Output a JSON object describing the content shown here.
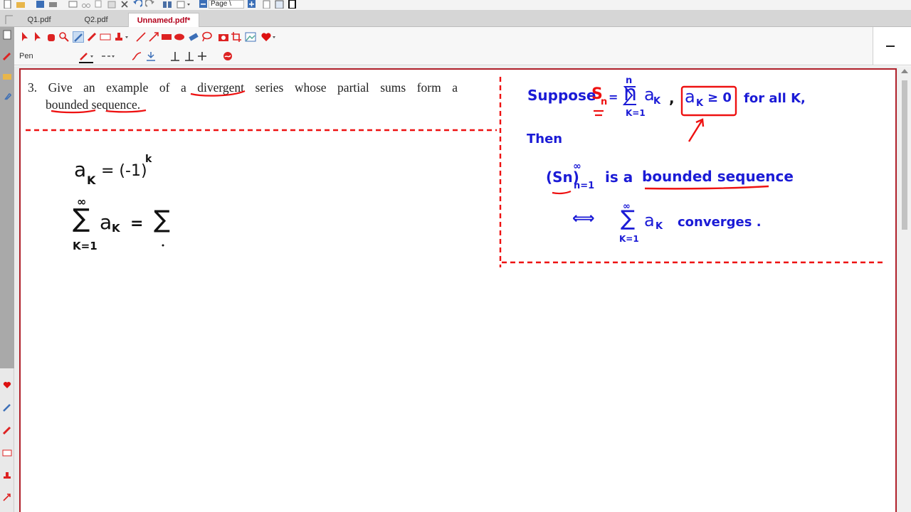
{
  "tabs": [
    {
      "label": "Q1.pdf",
      "active": false
    },
    {
      "label": "Q2.pdf",
      "active": false
    },
    {
      "label": "Unnamed.pdf*",
      "active": true
    }
  ],
  "quick_toolbar": {
    "page_dropdown": "Page \\"
  },
  "ribbon": {
    "tool_label": "Pen",
    "collapse_symbol": "–"
  },
  "problem": {
    "number": "3.",
    "line1_words": [
      "Give",
      "an",
      "example",
      "of",
      "a",
      "divergent",
      "series",
      "whose",
      "partial",
      "sums",
      "form",
      "a"
    ],
    "line2": "bounded sequence."
  },
  "handwriting": {
    "left": {
      "line1_base": "a",
      "line1_sub": "K",
      "line1_eq": "= (-1)",
      "line1_sup": "k",
      "line2_sigma": "∑",
      "line2_top": "∞",
      "line2_bottom": "K=1",
      "line2_body": "a",
      "line2_body_sub": "K",
      "line2_eq": "=",
      "line2_sigma2": "∑"
    },
    "right": {
      "suppose": "Suppose",
      "sn": "S",
      "sn_sub": "n",
      "eq": "=",
      "sum_top": "n",
      "sum_bottom": "K=1",
      "sum_body": "a",
      "sum_body_sub": "K",
      "comma": ",",
      "boxed": "a",
      "boxed_sub": "K",
      "boxed_rel": "≥ 0",
      "for_all": "for all K,",
      "then": "Then",
      "seq": "(Sn)",
      "seq_sup": "∞",
      "seq_sub": "n=1",
      "is_a": "is a",
      "bounded_seq": "bounded sequence",
      "iff": "⟺",
      "sum2_top": "∞",
      "sum2_bottom": "K=1",
      "sum2_body": "a",
      "sum2_body_sub": "K",
      "converges": "converges ."
    }
  },
  "colors": {
    "ink_black": "#111111",
    "ink_blue": "#1b1bd6",
    "ink_red": "#ee1111",
    "page_border": "#b0202a"
  }
}
